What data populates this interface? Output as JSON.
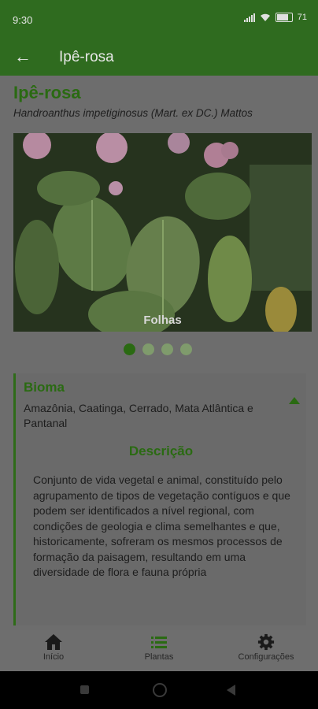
{
  "status_bar": {
    "time": "9:30",
    "battery": "71"
  },
  "app_bar": {
    "title": "Ipê-rosa"
  },
  "plant": {
    "name": "Ipê-rosa",
    "scientific_name": "Handroanthus impetiginosus (Mart. ex DC.) Mattos"
  },
  "gallery": {
    "caption": "Folhas",
    "page_count": 4,
    "active_index": 0
  },
  "bioma": {
    "title": "Bioma",
    "text": "Amazônia, Caatinga, Cerrado, Mata Atlântica e Pantanal"
  },
  "descricao": {
    "title": "Descrição",
    "text": "Conjunto de vida vegetal e animal, constituído pelo agrupamento de tipos de vegetação contíguos e que podem ser identificados a nível regional, com condições de geologia e clima semelhantes e que, historicamente, sofreram os mesmos processos de formação da paisagem, resultando em uma diversidade de flora e fauna própria"
  },
  "bottom_nav": {
    "items": [
      {
        "label": "Início",
        "icon": "home-icon"
      },
      {
        "label": "Plantas",
        "icon": "list-icon"
      },
      {
        "label": "Configurações",
        "icon": "gear-icon"
      }
    ]
  },
  "colors": {
    "accent": "#2a6a12",
    "app_bar": "#2f6b1f"
  }
}
